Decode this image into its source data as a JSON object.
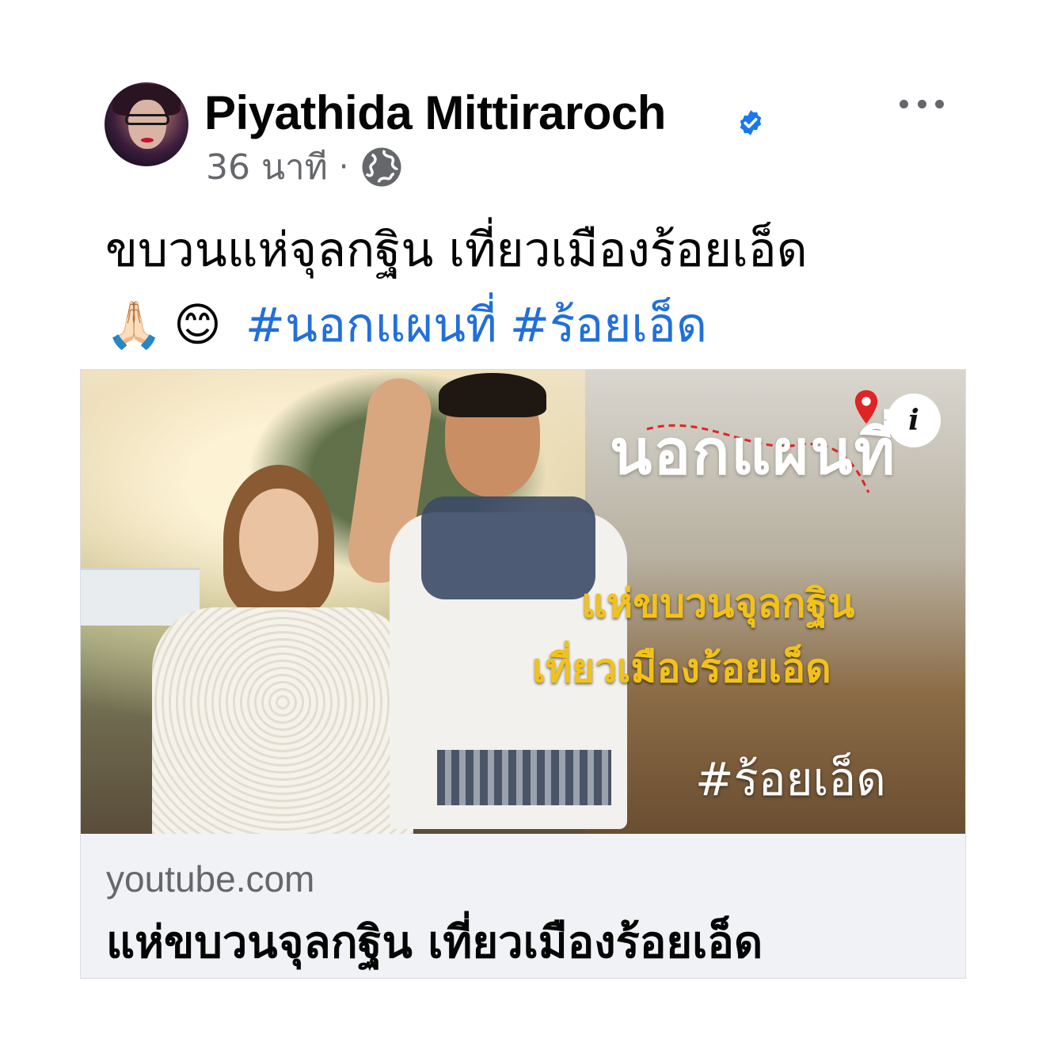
{
  "post": {
    "author": {
      "name": "Piyathida Mittiraroch",
      "verified_icon": "verified-badge-icon",
      "avatar_icon": "profile-photo"
    },
    "meta": {
      "time": "36 นาที",
      "separator": "·",
      "privacy_icon": "globe-icon"
    },
    "more_icon": "more-options-icon",
    "text": "ขบวนแห่จุลกฐิน เที่ยวเมืองร้อยเอ็ด",
    "line2": {
      "emoji_1": "🙏🏻",
      "emoji_2": "😊",
      "hashtags": [
        "#นอกแผนที่",
        "#ร้อยเอ็ด"
      ]
    }
  },
  "link_preview": {
    "thumbnail": {
      "logo_text": "นอกแผนที่",
      "info_badge": "i",
      "title_line1": "แห่ขบวนจุลกฐิน",
      "title_line2": "เที่ยวเมืองร้อยเอ็ด",
      "hashtag": "#ร้อยเอ็ด"
    },
    "domain": "youtube.com",
    "title": "แห่ขบวนจุลกฐิน เที่ยวเมืองร้อยเอ็ด"
  },
  "colors": {
    "text_primary": "#050505",
    "text_secondary": "#65676b",
    "link": "#216fdb",
    "verified": "#1877f2",
    "card_bg": "#f0f2f5",
    "thumbnail_title": "#f2c21a",
    "pin_red": "#e02424"
  }
}
